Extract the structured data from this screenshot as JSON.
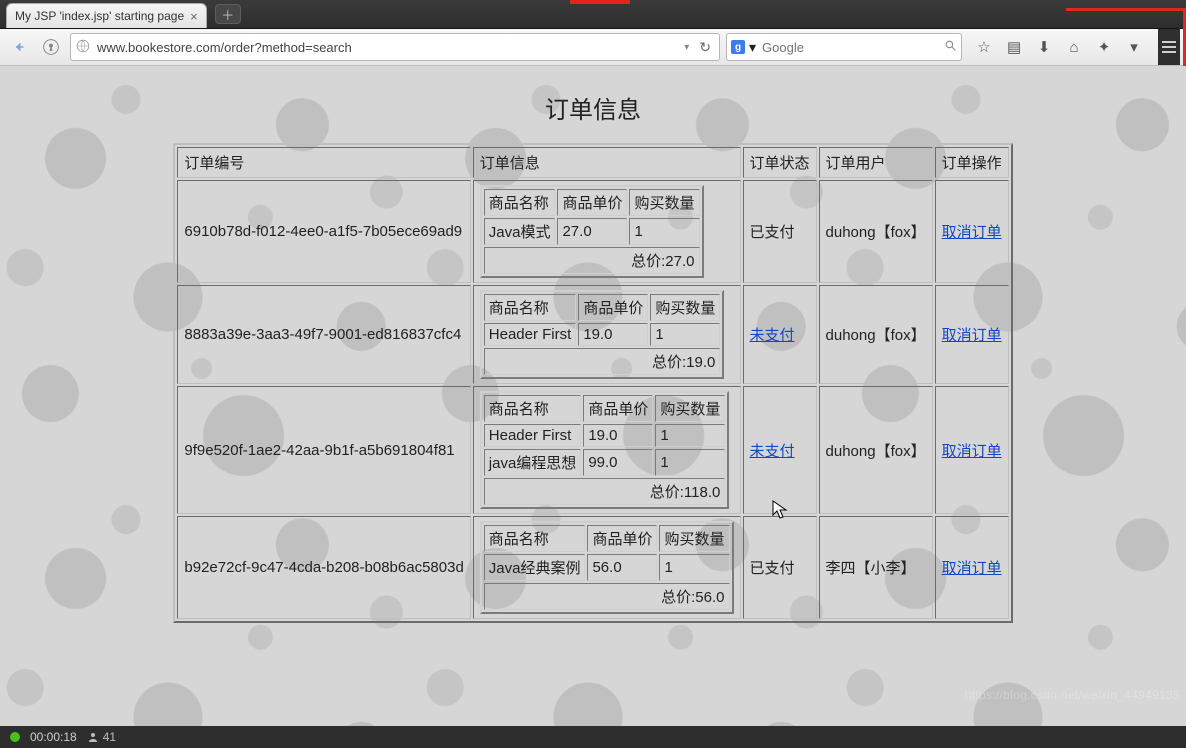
{
  "browser": {
    "tab_title": "My JSP 'index.jsp' starting page",
    "url": "www.bookestore.com/order?method=search",
    "search_placeholder": "Google"
  },
  "page": {
    "title": "订单信息",
    "headers": {
      "order_id": "订单编号",
      "order_info": "订单信息",
      "order_status": "订单状态",
      "order_user": "订单用户",
      "order_action": "订单操作"
    },
    "item_headers": {
      "name": "商品名称",
      "price": "商品单价",
      "qty": "购买数量"
    },
    "total_label": "总价",
    "cancel_label": "取消订单",
    "status_labels": {
      "paid": "已支付",
      "unpaid": "未支付"
    },
    "orders": [
      {
        "id": "6910b78d-f012-4ee0-a1f5-7b05ece69ad9",
        "items": [
          {
            "name": "Java模式",
            "price": "27.0",
            "qty": "1"
          }
        ],
        "total": "27.0",
        "status": "paid",
        "status_linked": false,
        "user": "duhong【fox】"
      },
      {
        "id": "8883a39e-3aa3-49f7-9001-ed816837cfc4",
        "items": [
          {
            "name": "Header First",
            "price": "19.0",
            "qty": "1"
          }
        ],
        "total": "19.0",
        "status": "unpaid",
        "status_linked": true,
        "user": "duhong【fox】"
      },
      {
        "id": "9f9e520f-1ae2-42aa-9b1f-a5b691804f81",
        "items": [
          {
            "name": "Header First",
            "price": "19.0",
            "qty": "1"
          },
          {
            "name": "java编程思想",
            "price": "99.0",
            "qty": "1"
          }
        ],
        "total": "118.0",
        "status": "unpaid",
        "status_linked": true,
        "user": "duhong【fox】"
      },
      {
        "id": "b92e72cf-9c47-4cda-b208-b08b6ac5803d",
        "items": [
          {
            "name": "Java经典案例",
            "price": "56.0",
            "qty": "1"
          }
        ],
        "total": "56.0",
        "status": "paid",
        "status_linked": false,
        "user": "李四【小李】"
      }
    ]
  },
  "statusbar": {
    "time": "00:00:18",
    "viewers": "41"
  },
  "watermark": "https://blog.csdn.net/weixin_44949135"
}
